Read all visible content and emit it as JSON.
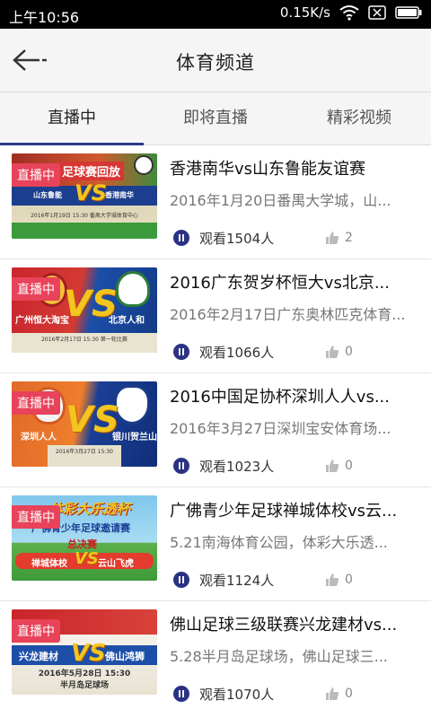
{
  "status": {
    "time": "上午10:56",
    "speed": "0.15K/s"
  },
  "header": {
    "title": "体育频道"
  },
  "tabs": [
    {
      "label": "直播中",
      "active": true
    },
    {
      "label": "即将直播",
      "active": false
    },
    {
      "label": "精彩视频",
      "active": false
    }
  ],
  "items": [
    {
      "badge": "直播中",
      "title": "香港南华vs山东鲁能友谊赛",
      "desc": "2016年1月20日番禺大学城，山...",
      "views": "观看1504人",
      "likes": "2",
      "poster": {
        "banner": "足球赛回放",
        "team_a": "山东鲁能",
        "team_b": "香港南华",
        "date": "2016年1月19日 15:30 番禺大学城体育中心"
      }
    },
    {
      "badge": "直播中",
      "title": "2016广东贺岁杯恒大vs北京...",
      "desc": "2016年2月17日广东奥林匹克体育...",
      "views": "观看1066人",
      "likes": "0",
      "poster": {
        "team_a": "广州恒大淘宝",
        "team_b": "北京人和",
        "date": "2016年2月17日 15:30 第一轮比赛"
      }
    },
    {
      "badge": "直播中",
      "title": "2016中国足协杯深圳人人vs...",
      "desc": "2016年3月27日深圳宝安体育场...",
      "views": "观看1023人",
      "likes": "0",
      "poster": {
        "team_a": "深圳人人",
        "team_b": "银川贺兰山",
        "date": "2016年3月27日 15:30"
      }
    },
    {
      "badge": "直播中",
      "title": "广佛青少年足球禅城体校vs云...",
      "desc": "5.21南海体育公园，体彩大乐透...",
      "views": "观看1124人",
      "likes": "0",
      "poster": {
        "banner": "体彩大乐透杯",
        "sub": "广佛青少年足球邀请赛",
        "stage": "总决赛",
        "team_a": "禅城体校",
        "team_b": "云山飞虎"
      }
    },
    {
      "badge": "直播中",
      "title": "佛山足球三级联赛兴龙建材vs...",
      "desc": "5.28半月岛足球场，佛山足球三...",
      "views": "观看1070人",
      "likes": "0",
      "poster": {
        "team_a": "兴龙建材",
        "team_b": "佛山鸿狮",
        "date": "2016年5月28日 15:30",
        "venue": "半月岛足球场"
      }
    }
  ],
  "colors": {
    "accent": "#2b3a8f",
    "badge": "#e8435a",
    "play": "#2b3284"
  }
}
